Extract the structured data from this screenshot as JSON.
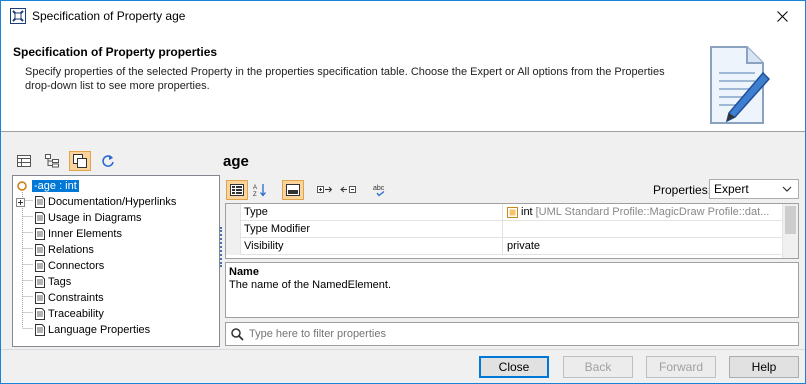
{
  "window": {
    "title": "Specification of Property age"
  },
  "header": {
    "title": "Specification of Property properties",
    "description": "Specify properties of the selected Property in the properties specification table. Choose the Expert or All options from the Properties drop-down list to see more properties."
  },
  "tree": {
    "root": "-age : int",
    "items": [
      {
        "label": "Documentation/Hyperlinks",
        "expandable": true
      },
      {
        "label": "Usage in Diagrams"
      },
      {
        "label": "Inner Elements"
      },
      {
        "label": "Relations"
      },
      {
        "label": "Connectors"
      },
      {
        "label": "Tags"
      },
      {
        "label": "Constraints"
      },
      {
        "label": "Traceability"
      },
      {
        "label": "Language Properties"
      }
    ]
  },
  "element_name": "age",
  "properties": {
    "label": "Properties:",
    "selected": "Expert",
    "rows": [
      {
        "name": "Type",
        "value": "int",
        "value_extra": "[UML Standard Profile::MagicDraw Profile::dat..."
      },
      {
        "name": "Type Modifier",
        "value": ""
      },
      {
        "name": "Visibility",
        "value": "private"
      }
    ]
  },
  "description": {
    "title": "Name",
    "text": "The name of the NamedElement."
  },
  "filter": {
    "placeholder": "Type here to filter properties"
  },
  "buttons": {
    "close": "Close",
    "back": "Back",
    "forward": "Forward",
    "help": "Help"
  },
  "colors": {
    "accent": "#0078d7",
    "active_toggle": "#fbd49b"
  }
}
